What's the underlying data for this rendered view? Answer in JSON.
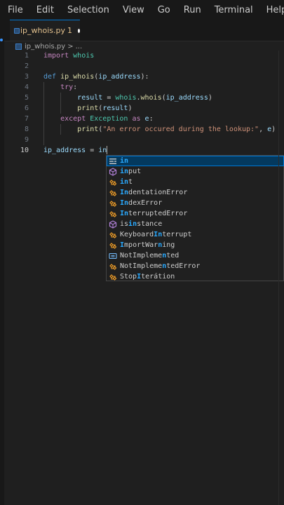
{
  "menu": {
    "file": "File",
    "edit": "Edit",
    "selection": "Selection",
    "view": "View",
    "go": "Go",
    "run": "Run",
    "terminal": "Terminal",
    "help": "Help"
  },
  "tab": {
    "filename": "ip_whois.py",
    "problems": "1"
  },
  "breadcrumb": {
    "file": "ip_whois.py",
    "sep": ">",
    "more": "..."
  },
  "code": {
    "line_numbers": [
      "1",
      "2",
      "3",
      "4",
      "5",
      "6",
      "7",
      "8",
      "9",
      "10"
    ],
    "l1_kw": "import",
    "l1_mod": "whois",
    "l3_kw": "def",
    "l3_fn": "ip_whois",
    "l3_p1": "(",
    "l3_param": "ip_address",
    "l3_p2": "):",
    "l4_kw": "try",
    "l4_colon": ":",
    "l5_var": "result",
    "l5_eq": " = ",
    "l5_mod": "whois",
    "l5_dot": ".",
    "l5_fn": "whois",
    "l5_p1": "(",
    "l5_arg": "ip_address",
    "l5_p2": ")",
    "l6_fn": "print",
    "l6_p1": "(",
    "l6_arg": "result",
    "l6_p2": ")",
    "l7_kw": "except",
    "l7_cls": "Exception",
    "l7_as": "as",
    "l7_var": "e",
    "l7_colon": ":",
    "l8_fn": "print",
    "l8_p1": "(",
    "l8_str": "\"An error occured during the lookup:\"",
    "l8_comma": ", ",
    "l8_var": "e",
    "l8_p2": ")",
    "l10_var": "ip_address",
    "l10_eq": " = ",
    "l10_typed": "in"
  },
  "suggestions": [
    {
      "match": "in",
      "rest": "",
      "pre": "",
      "icon": "keyword-icon",
      "selected": true
    },
    {
      "pre": "",
      "match": "in",
      "rest": "put",
      "icon": "function-cube-icon"
    },
    {
      "pre": "",
      "match": "in",
      "rest": "t",
      "icon": "class-icon"
    },
    {
      "pre": "",
      "match": "In",
      "rest": "dentationError",
      "icon": "class-icon"
    },
    {
      "pre": "",
      "match": "In",
      "rest": "dexError",
      "icon": "class-icon"
    },
    {
      "pre": "",
      "match": "In",
      "rest": "terruptedError",
      "icon": "class-icon"
    },
    {
      "pre": "is",
      "match": "in",
      "rest": "stance",
      "icon": "function-cube-icon"
    },
    {
      "pre": "Keyboard",
      "match": "In",
      "rest": "terrupt",
      "icon": "class-icon"
    },
    {
      "pre": "",
      "match": "I",
      "rest": "mportWar",
      "match2": "n",
      "rest2": "ing",
      "icon": "class-icon"
    },
    {
      "pre": "NotImpleme",
      "match": "n",
      "rest": "ted",
      "icon": "constant-icon"
    },
    {
      "pre": "NotImpleme",
      "match": "n",
      "rest": "tedError",
      "icon": "class-icon"
    },
    {
      "pre": "Stop",
      "match": "I",
      "rest": "terátion",
      "icon": "class-icon"
    }
  ],
  "colors": {
    "accent": "#0078d4",
    "class_icon": "#ee9d28",
    "function_icon": "#b180d7",
    "match": "#2aaaff"
  }
}
